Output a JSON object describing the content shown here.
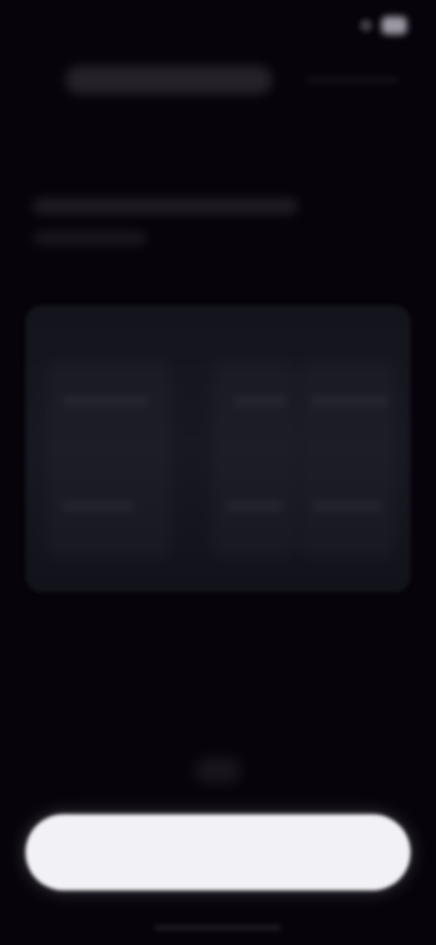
{
  "status_bar": {
    "time": "",
    "icons": [
      "signal-icon",
      "battery-icon"
    ]
  },
  "header": {
    "title": "",
    "subtitle": ""
  },
  "page": {
    "title": "",
    "description_line_1": "",
    "description_line_2": ""
  },
  "card": {
    "labels": [
      "",
      "",
      ""
    ]
  },
  "actions": {
    "primary_label": ""
  },
  "colors": {
    "background": "#06030b",
    "card": "#14141c",
    "button": "#f2f2f6"
  }
}
